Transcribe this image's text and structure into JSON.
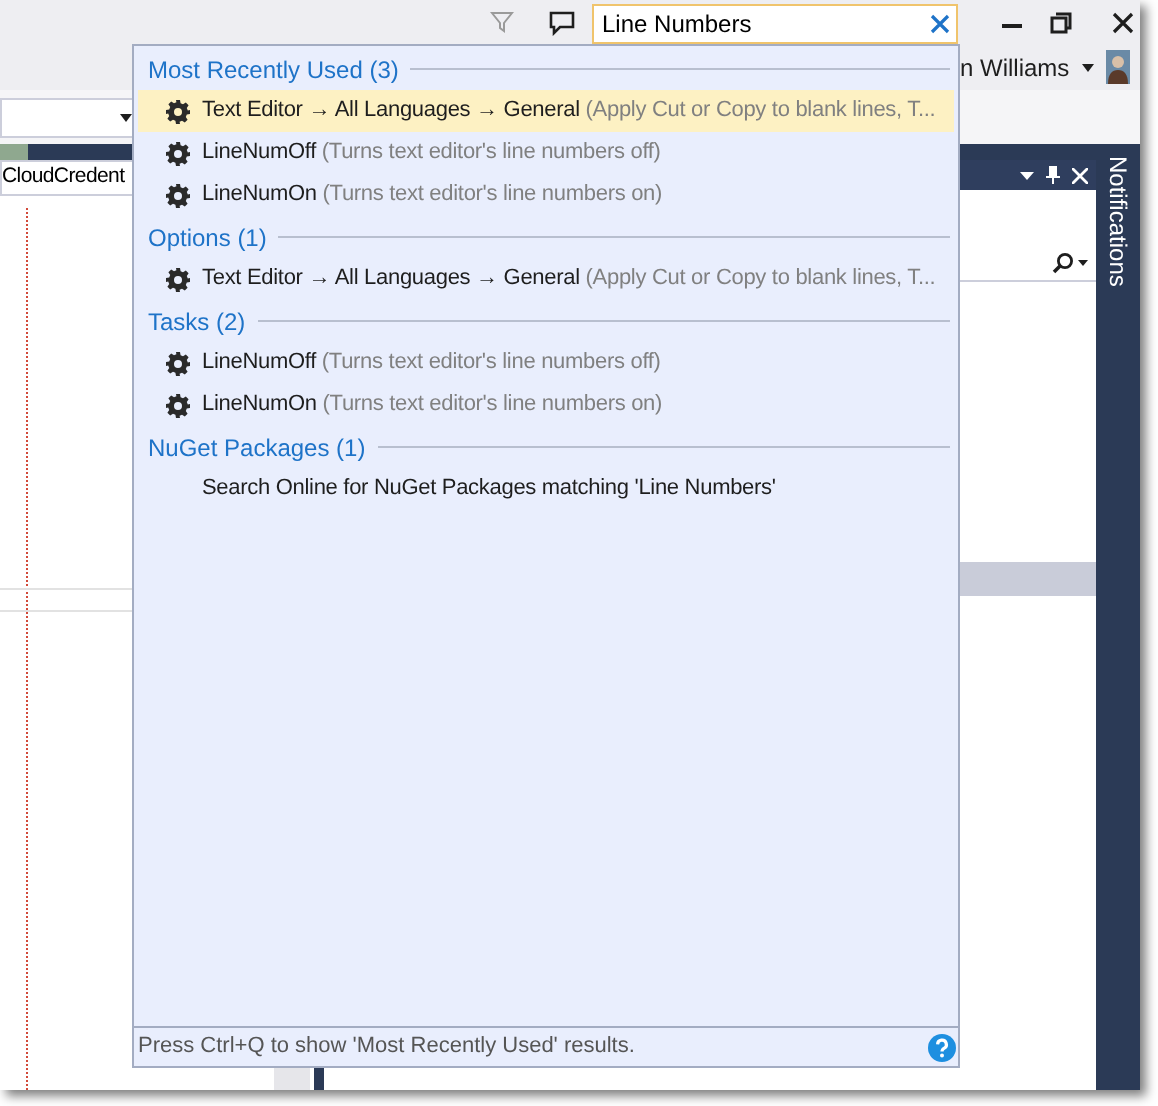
{
  "title_bar": {
    "search": {
      "value": "Line Numbers"
    },
    "user_name": "n Williams"
  },
  "document_tab": {
    "label": "CloudCredent"
  },
  "notifications_tab": {
    "label": "Notifications"
  },
  "quick_launch": {
    "groups": [
      {
        "title": "Most Recently Used (3)",
        "items": [
          {
            "kind": "command",
            "label": "Text Editor → All Languages → General",
            "detail": "(Apply Cut or Copy to blank lines, T...",
            "selected": true
          },
          {
            "kind": "command",
            "label": "LineNumOff",
            "detail": "(Turns text editor's line numbers off)",
            "selected": false
          },
          {
            "kind": "command",
            "label": "LineNumOn",
            "detail": "(Turns text editor's line numbers on)",
            "selected": false
          }
        ]
      },
      {
        "title": "Options (1)",
        "items": [
          {
            "kind": "command",
            "label": "Text Editor → All Languages → General",
            "detail": "(Apply Cut or Copy to blank lines, T...",
            "selected": false
          }
        ]
      },
      {
        "title": "Tasks (2)",
        "items": [
          {
            "kind": "command",
            "label": "LineNumOff",
            "detail": "(Turns text editor's line numbers off)",
            "selected": false
          },
          {
            "kind": "command",
            "label": "LineNumOn",
            "detail": "(Turns text editor's line numbers on)",
            "selected": false
          }
        ]
      },
      {
        "title": "NuGet Packages (1)",
        "items": [
          {
            "kind": "search",
            "label": "Search Online for NuGet Packages matching 'Line Numbers'",
            "selected": false
          }
        ]
      }
    ],
    "footer": "Press Ctrl+Q to show 'Most Recently Used' results."
  }
}
